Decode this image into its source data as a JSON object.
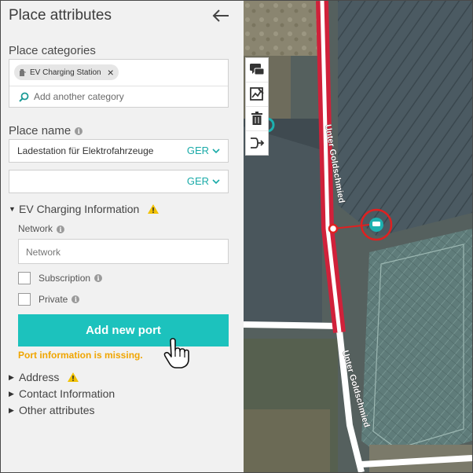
{
  "panel": {
    "title": "Place attributes",
    "categories_label": "Place categories",
    "category_chip": "EV Charging Station",
    "add_category_placeholder": "Add another category",
    "place_name_label": "Place name",
    "name_value": "Ladestation für Elektrofahrzeuge",
    "name_lang": "GER",
    "name2_value": "",
    "name2_lang": "GER",
    "ev_section": "EV Charging Information",
    "network_label": "Network",
    "network_placeholder": "Network",
    "subscription_label": "Subscription",
    "private_label": "Private",
    "add_port_button": "Add new port",
    "port_missing_msg": "Port information is missing.",
    "address_section": "Address",
    "contact_section": "Contact Information",
    "other_section": "Other attributes"
  },
  "map": {
    "street_label_1": "Unter Goldschmied",
    "street_label_2": "Unter Goldschmied"
  },
  "colors": {
    "accent": "#1cc2bd",
    "warning": "#f0a500",
    "road_selected": "#d0213a",
    "marker": "#e02020"
  },
  "icons": {
    "back": "arrow-left-icon",
    "search": "search-icon",
    "warning": "warning-triangle-icon",
    "tools": [
      "comment-icon",
      "image-edit-icon",
      "trash-icon",
      "route-arrow-icon"
    ]
  }
}
